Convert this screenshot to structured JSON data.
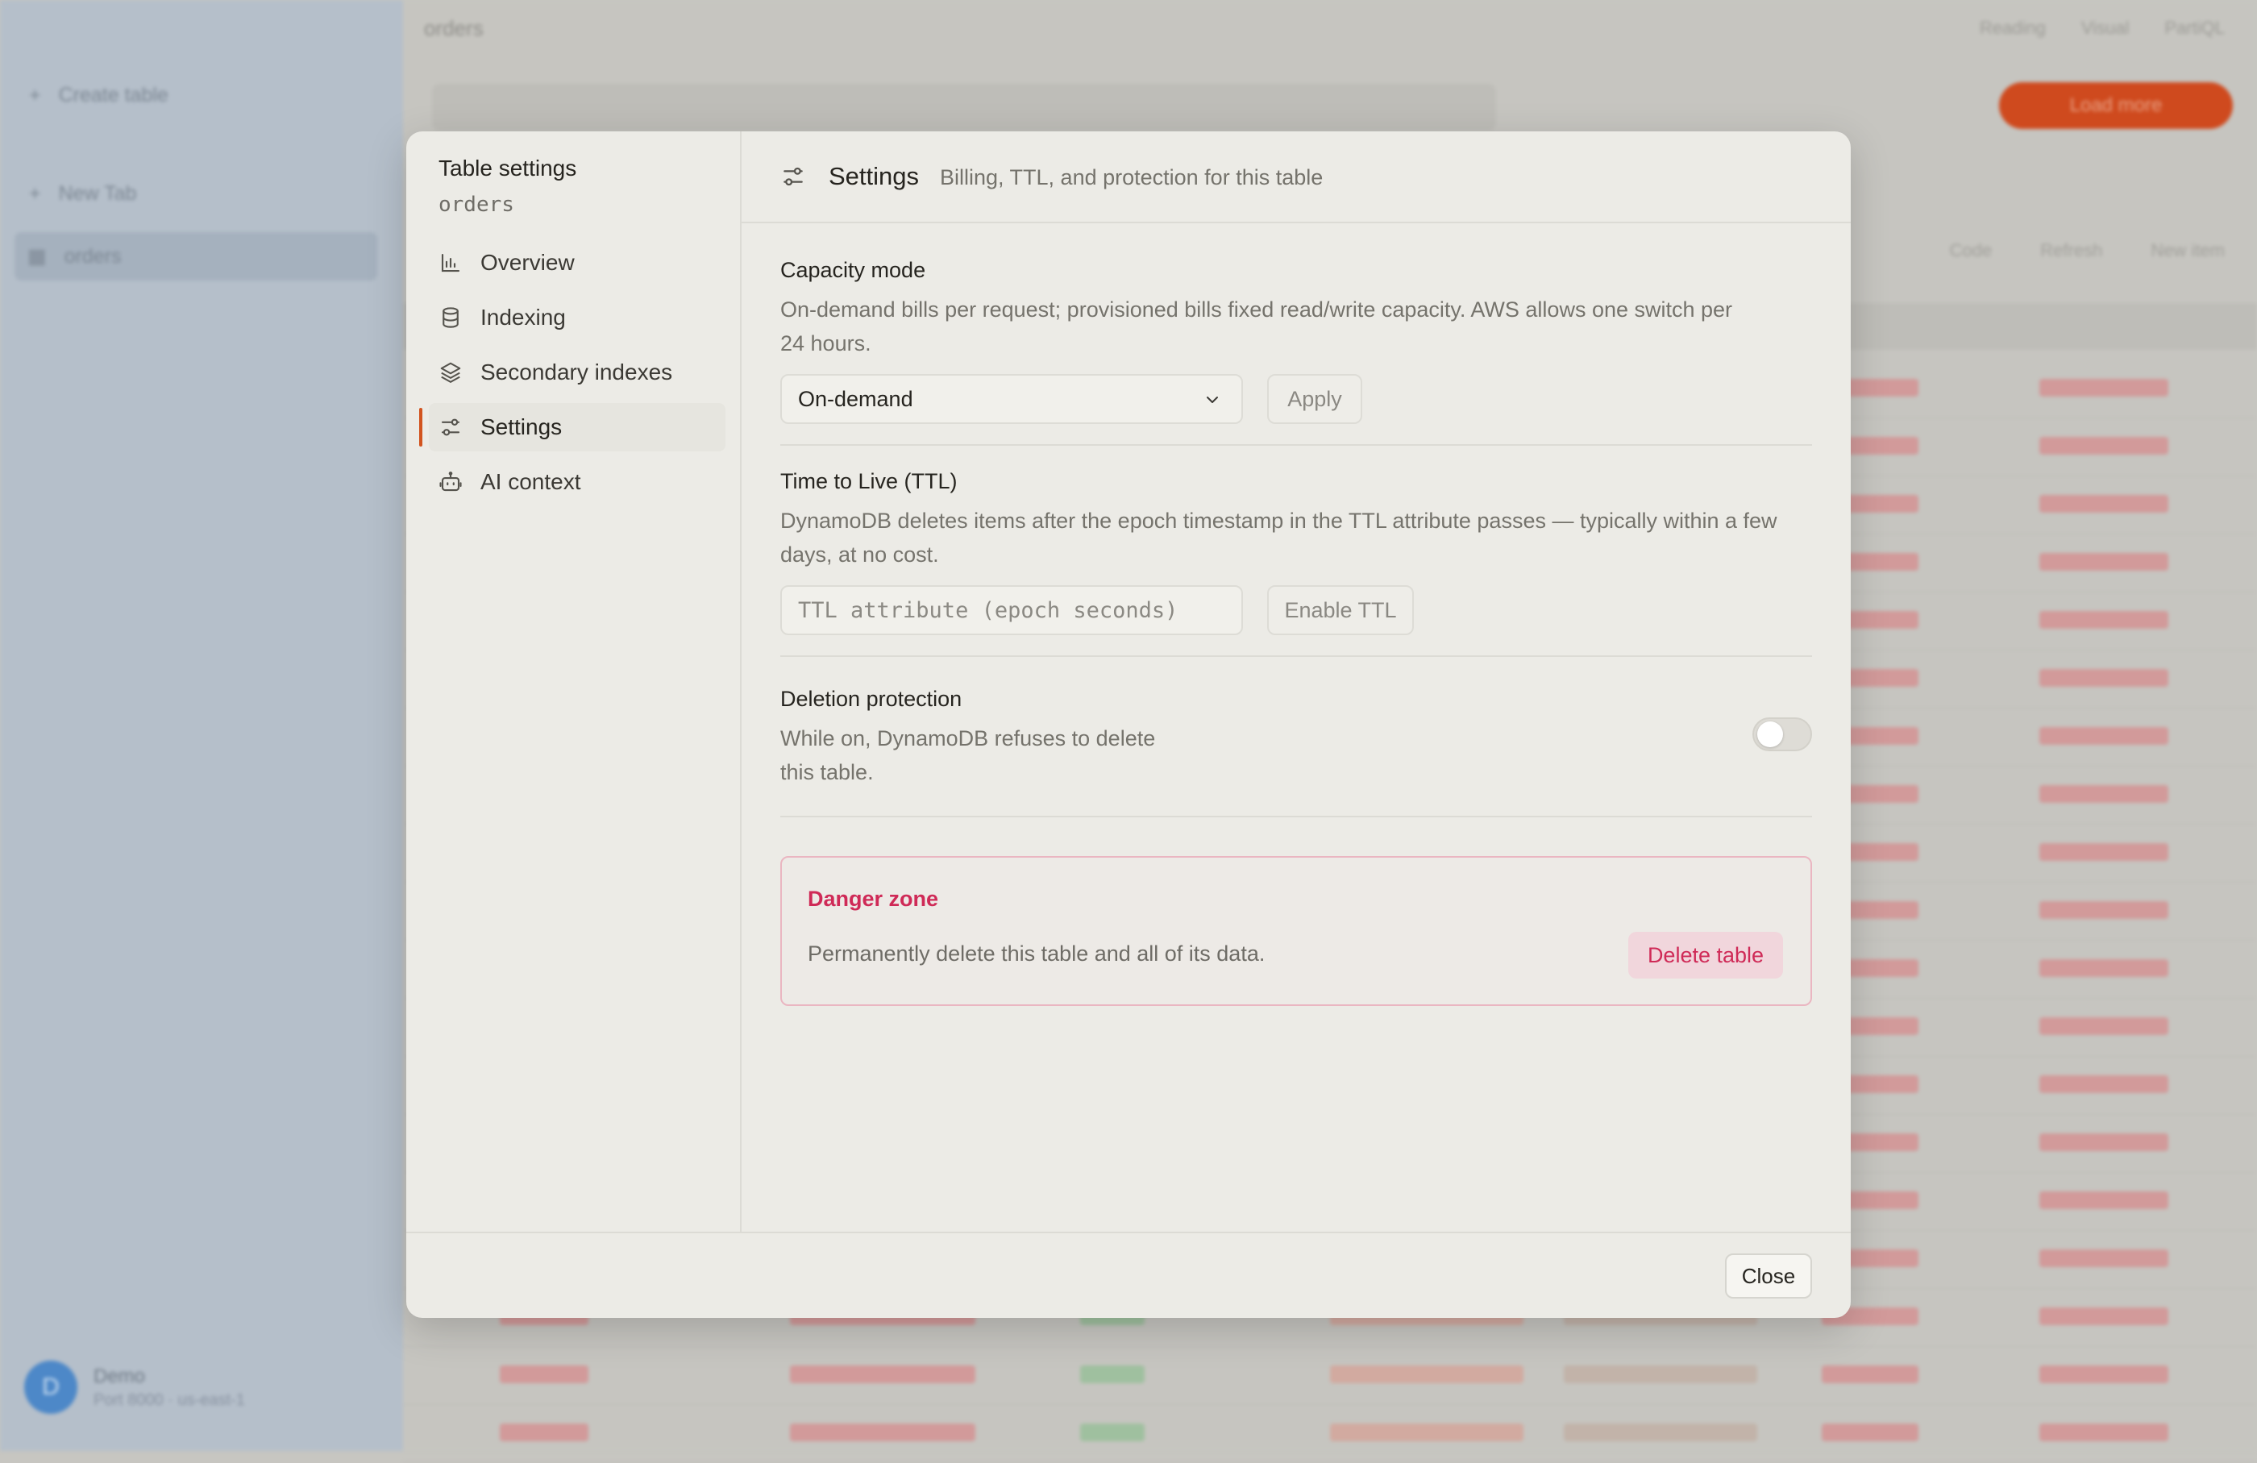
{
  "background": {
    "sidebar": {
      "create_table": "Create table",
      "new_tab": "New Tab",
      "active_table": "orders",
      "user_name": "Demo",
      "user_sub": "Port 8000 · us-east-1",
      "avatar_initial": "D"
    },
    "topbar": {
      "table_name": "orders",
      "right_items": [
        "Reading",
        "Visual",
        "PartiQL"
      ]
    },
    "load_button": "Load more",
    "toolbar": [
      "Code",
      "Refresh",
      "New item"
    ]
  },
  "modal": {
    "sidebar": {
      "title": "Table settings",
      "subtitle": "orders",
      "nav": [
        {
          "label": "Overview",
          "icon": "bar-chart-icon"
        },
        {
          "label": "Indexing",
          "icon": "database-icon"
        },
        {
          "label": "Secondary indexes",
          "icon": "layers-icon"
        },
        {
          "label": "Settings",
          "icon": "sliders-icon",
          "active": true
        },
        {
          "label": "AI context",
          "icon": "robot-icon"
        }
      ]
    },
    "header": {
      "title": "Settings",
      "description": "Billing, TTL, and protection for this table"
    },
    "capacity": {
      "label": "Capacity mode",
      "description": "On-demand bills per request; provisioned bills fixed read/write capacity. AWS allows one switch per 24 hours.",
      "selected": "On-demand",
      "apply_label": "Apply"
    },
    "ttl": {
      "label": "Time to Live (TTL)",
      "description": "DynamoDB deletes items after the epoch timestamp in the TTL attribute passes — typically within a few days, at no cost.",
      "placeholder": "TTL attribute (epoch seconds)",
      "enable_label": "Enable TTL"
    },
    "deletion_protection": {
      "label": "Deletion protection",
      "description": "While on, DynamoDB refuses to delete this table.",
      "enabled": false
    },
    "danger_zone": {
      "title": "Danger zone",
      "description": "Permanently delete this table and all of its data.",
      "button_label": "Delete table"
    },
    "footer": {
      "close_label": "Close"
    },
    "colors": {
      "accent": "#d2541f",
      "danger": "#cf2a57"
    }
  }
}
